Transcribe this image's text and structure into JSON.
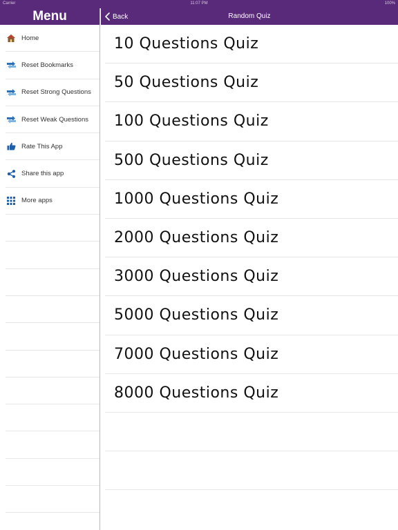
{
  "status_bar": {
    "carrier": "Carrier",
    "time": "11:07 PM",
    "battery": "100%"
  },
  "sidebar": {
    "title": "Menu",
    "items": [
      {
        "label": "Home",
        "icon": "house-icon"
      },
      {
        "label": "Reset Bookmarks",
        "icon": "reset-icon"
      },
      {
        "label": "Reset Strong Questions",
        "icon": "reset-icon"
      },
      {
        "label": "Reset Weak Questions",
        "icon": "reset-icon"
      },
      {
        "label": "Rate This App",
        "icon": "thumbs-up-icon"
      },
      {
        "label": "Share this app",
        "icon": "share-icon"
      },
      {
        "label": "More apps",
        "icon": "grid-icon"
      }
    ]
  },
  "navbar": {
    "back_label": "Back",
    "title": "Random Quiz"
  },
  "quizzes": [
    {
      "label": "10 Questions Quiz"
    },
    {
      "label": "50 Questions Quiz"
    },
    {
      "label": "100 Questions Quiz"
    },
    {
      "label": "500 Questions Quiz"
    },
    {
      "label": "1000 Questions Quiz"
    },
    {
      "label": "2000 Questions Quiz"
    },
    {
      "label": "3000 Questions Quiz"
    },
    {
      "label": "5000 Questions Quiz"
    },
    {
      "label": "7000 Questions Quiz"
    },
    {
      "label": "8000 Questions Quiz"
    }
  ],
  "colors": {
    "accent": "#5a2a7a",
    "icon_blue": "#1f5fa8",
    "house": "#7a4a2a"
  }
}
